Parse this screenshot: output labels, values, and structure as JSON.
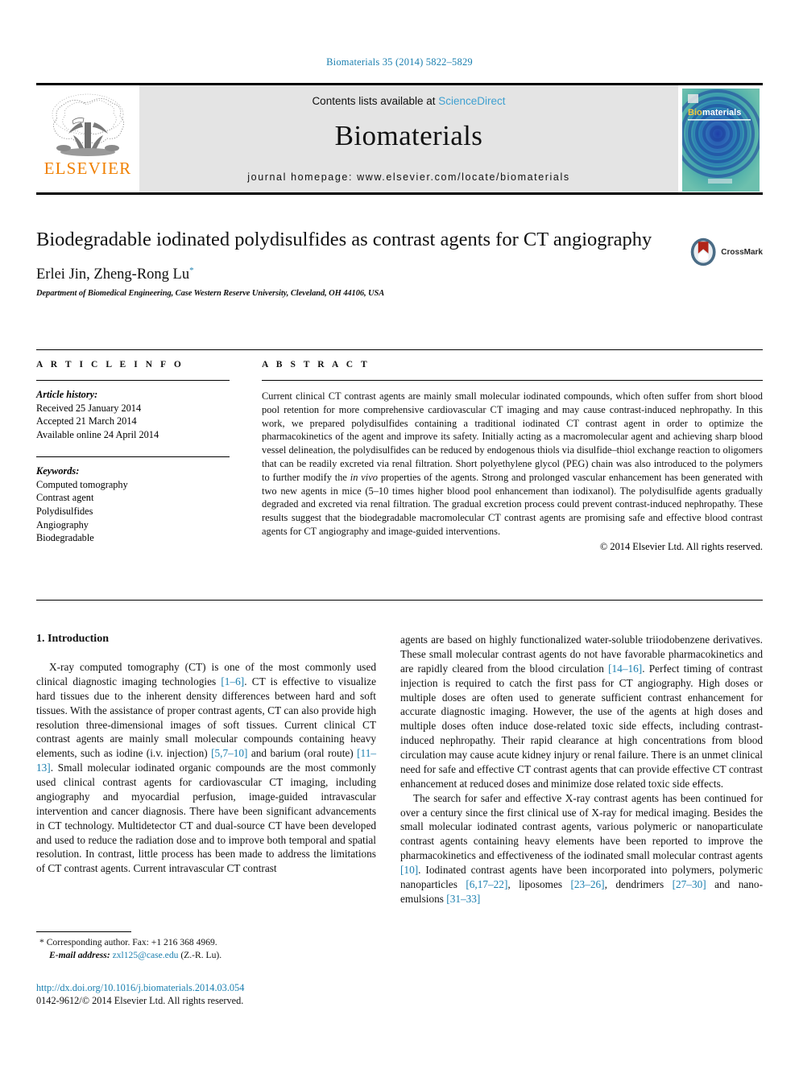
{
  "running_head": "Biomaterials 35 (2014) 5822–5829",
  "masthead": {
    "contents_prefix": "Contents lists available at ",
    "sciencedirect": "ScienceDirect",
    "journal_name": "Biomaterials",
    "homepage": "journal homepage: www.elsevier.com/locate/biomaterials",
    "publisher_wordmark": "ELSEVIER",
    "cover_title_bio": "Bio",
    "cover_title_materials": "materials",
    "accent_link_color": "#3fa0d0",
    "elsevier_orange": "#f08000"
  },
  "article": {
    "title": "Biodegradable iodinated polydisulfides as contrast agents for CT angiography",
    "authors": "Erlei Jin, Zheng-Rong Lu",
    "author_marker": "*",
    "affiliation": "Department of Biomedical Engineering, Case Western Reserve University, Cleveland, OH 44106, USA",
    "crossmark_label": "CrossMark"
  },
  "article_info": {
    "heading": "A R T I C L E   I N F O",
    "history_label": "Article history:",
    "history": [
      "Received 25 January 2014",
      "Accepted 21 March 2014",
      "Available online 24 April 2014"
    ],
    "keywords_label": "Keywords:",
    "keywords": [
      "Computed tomography",
      "Contrast agent",
      "Polydisulfides",
      "Angiography",
      "Biodegradable"
    ]
  },
  "abstract": {
    "heading": "A B S T R A C T",
    "part1": "Current clinical CT contrast agents are mainly small molecular iodinated compounds, which often suffer from short blood pool retention for more comprehensive cardiovascular CT imaging and may cause contrast-induced nephropathy. In this work, we prepared polydisulfides containing a traditional iodinated CT contrast agent in order to optimize the pharmacokinetics of the agent and improve its safety. Initially acting as a macromolecular agent and achieving sharp blood vessel delineation, the polydisulfides can be reduced by endogenous thiols via disulfide–thiol exchange reaction to oligomers that can be readily excreted via renal filtration. Short polyethylene glycol (PEG) chain was also introduced to the polymers to further modify the ",
    "italic_term": "in vivo",
    "part2": " properties of the agents. Strong and prolonged vascular enhancement has been generated with two new agents in mice (5–10 times higher blood pool enhancement than iodixanol). The polydisulfide agents gradually degraded and excreted via renal filtration. The gradual excretion process could prevent contrast-induced nephropathy. These results suggest that the biodegradable macromolecular CT contrast agents are promising safe and effective blood contrast agents for CT angiography and image-guided interventions.",
    "copyright": "© 2014 Elsevier Ltd. All rights reserved."
  },
  "introduction": {
    "heading": "1.  Introduction",
    "left": {
      "p1_a": "X-ray computed tomography (CT) is one of the most commonly used clinical diagnostic imaging technologies ",
      "p1_r1": "[1–6]",
      "p1_b": ". CT is effective to visualize hard tissues due to the inherent density differences between hard and soft tissues. With the assistance of proper contrast agents, CT can also provide high resolution three-dimensional images of soft tissues. Current clinical CT contrast agents are mainly small molecular compounds containing heavy elements, such as iodine (i.v. injection) ",
      "p1_r2": "[5,7–10]",
      "p1_c": " and barium (oral route) ",
      "p1_r3": "[11–13]",
      "p1_d": ". Small molecular iodinated organic compounds are the most commonly used clinical contrast agents for cardiovascular CT imaging, including angiography and myocardial perfusion, image-guided intravascular intervention and cancer diagnosis. There have been significant advancements in CT technology. Multidetector CT and dual-source CT have been developed and used to reduce the radiation dose and to improve both temporal and spatial resolution. In contrast, little process has been made to address the limitations of CT contrast agents. Current intravascular CT contrast"
    },
    "right": {
      "p1_cont_a": "agents are based on highly functionalized water-soluble triiodobenzene derivatives. These small molecular contrast agents do not have favorable pharmacokinetics and are rapidly cleared from the blood circulation ",
      "p1_cont_r1": "[14–16]",
      "p1_cont_b": ". Perfect timing of contrast injection is required to catch the first pass for CT angiography. High doses or multiple doses are often used to generate sufficient contrast enhancement for accurate diagnostic imaging. However, the use of the agents at high doses and multiple doses often induce dose-related toxic side effects, including contrast-induced nephropathy. Their rapid clearance at high concentrations from blood circulation may cause acute kidney injury or renal failure. There is an unmet clinical need for safe and effective CT contrast agents that can provide effective CT contrast enhancement at reduced doses and minimize dose related toxic side effects.",
      "p2_a": "The search for safer and effective X-ray contrast agents has been continued for over a century since the first clinical use of X-ray for medical imaging. Besides the small molecular iodinated contrast agents, various polymeric or nanoparticulate contrast agents containing heavy elements have been reported to improve the pharmacokinetics and effectiveness of the iodinated small molecular contrast agents ",
      "p2_r1": "[10]",
      "p2_b": ". Iodinated contrast agents have been incorporated into polymers, polymeric nanoparticles ",
      "p2_r2": "[6,17–22]",
      "p2_c": ", liposomes ",
      "p2_r3": "[23–26]",
      "p2_d": ", dendrimers ",
      "p2_r4": "[27–30]",
      "p2_e": " and nano-emulsions ",
      "p2_r5": "[31–33]"
    }
  },
  "footer": {
    "corresponding_marker": "*",
    "corresponding_text": " Corresponding author. Fax: +1 216 368 4969.",
    "email_label": "E-mail address:",
    "email": "zxl125@case.edu",
    "email_suffix": " (Z.-R. Lu).",
    "doi": "http://dx.doi.org/10.1016/j.biomaterials.2014.03.054",
    "issn": "0142-9612/© 2014 Elsevier Ltd. All rights reserved."
  }
}
